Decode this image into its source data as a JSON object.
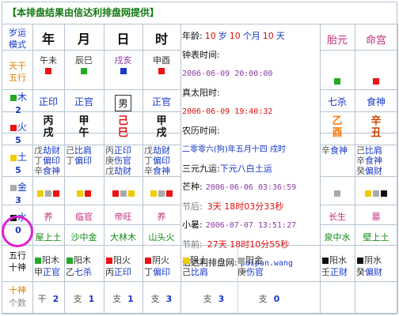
{
  "banner": "【本排盘结果由信达利排盘网提供】",
  "left": {
    "mode": [
      "岁运",
      "模式"
    ],
    "tiangan": [
      "天干",
      "五行"
    ],
    "elements": [
      {
        "name": "木",
        "count": "2",
        "color": "#22aa22"
      },
      {
        "name": "火",
        "count": "5",
        "color": "#ee1111"
      },
      {
        "name": "土",
        "count": "5",
        "color": "#eecc00"
      },
      {
        "name": "金",
        "count": "3",
        "color": "#aaaaaa"
      },
      {
        "name": "水",
        "count": "0",
        "color": "#111111"
      }
    ],
    "bottom1": [
      "五行",
      "十神"
    ],
    "bottom2": [
      "十神",
      "个数"
    ]
  },
  "pillars": {
    "headers": [
      "年",
      "月",
      "日",
      "时"
    ],
    "branches_sub": [
      "午未",
      "辰巳",
      "戌亥",
      "申酉"
    ],
    "branch_colors": [
      "#ee1111",
      "#22aa22",
      "#1838c8",
      "#ee1111"
    ],
    "shishen": [
      "正印",
      "正官",
      "男",
      "正官"
    ],
    "ganzhi": [
      {
        "gan": "丙",
        "zhi": "戌",
        "color": "#111"
      },
      {
        "gan": "甲",
        "zhi": "午",
        "color": "#111"
      },
      {
        "gan": "己",
        "zhi": "巳",
        "color": "#e01010"
      },
      {
        "gan": "甲",
        "zhi": "戌",
        "color": "#111"
      }
    ],
    "canggan": [
      [
        "戊劫财",
        "丁偏印",
        "辛食神"
      ],
      [
        "己比肩",
        "丁偏印",
        ""
      ],
      [
        "丙正印",
        "庚伤官",
        "戊劫财"
      ],
      [
        "戊劫财",
        "丁偏印",
        "辛食神"
      ]
    ],
    "dizhi_sq": [
      [
        "#eecc00",
        "#aaaaaa",
        "#ee1111"
      ],
      [
        "#eecc00",
        "#ee1111",
        ""
      ],
      [
        "#ee1111",
        "#aaaaaa",
        "#eecc00"
      ],
      [
        "#eecc00",
        "#aaaaaa",
        "#ee1111"
      ]
    ],
    "changsheng": [
      "养",
      "临官",
      "帝旺",
      "养"
    ],
    "nayin": [
      "屋上土",
      "沙中金",
      "大林木",
      "山头火"
    ],
    "bottom_wx": [
      [
        "阳木",
        "甲",
        "正官",
        "#22aa22"
      ],
      [
        "阳木",
        "乙",
        "七杀",
        "#22aa22"
      ],
      [
        "阳火",
        "丙",
        "正印",
        "#ee1111"
      ],
      [
        "阴火",
        "丁",
        "偏印",
        "#ee1111"
      ]
    ],
    "counts": [
      [
        "干",
        "2"
      ],
      [
        "支",
        "1"
      ],
      [
        "支",
        "1"
      ],
      [
        "支",
        "3"
      ]
    ]
  },
  "info": {
    "age_label": "年龄:",
    "age_num1": "10",
    "age_u1": "岁",
    "age_num2": "10",
    "age_u2": "个月",
    "age_num3": "10",
    "age_u3": "天",
    "clock_label": "钟表时间:",
    "clock_value": "2006-06-09 20:00:00",
    "solar_label": "真太阳时:",
    "solar_value": "2006-06-09 19:40:32",
    "lunar_label": "农历时间:",
    "lunar_value": "二零零六(狗)年五月十四 戌时",
    "yuan_label": "三元九运:",
    "yuan_value": "下元八白土运",
    "mangzhong_label": "芒种:",
    "mangzhong_value": "2006-06-06 03:36:59",
    "jieqian_label": "节后:",
    "jieqian_value": "3天 18时03分33秒",
    "xiaoshu_label": "小暑:",
    "xiaoshu_value": "2006-07-07 13:51:27",
    "jiehou_label": "节前:",
    "jiehou_value": "27天 18时10分55秒",
    "site_label": "信达利排盘网:",
    "site_value": "paipan.wang",
    "row_a": [
      "阴土",
      "己",
      "比肩",
      "#eecc00"
    ],
    "row_b": [
      "阳金",
      "庚",
      "伤官",
      "#aaaaaa"
    ],
    "count_a": [
      "支",
      "3"
    ],
    "count_b": [
      "支",
      "0"
    ]
  },
  "right": {
    "headers": [
      "胎元",
      "命宫"
    ],
    "sq_colors": [
      "#22aa22",
      "#ee1111"
    ],
    "shishen": [
      "七杀",
      "食神"
    ],
    "ganzhi": [
      {
        "gan": "乙",
        "zhi": "酉",
        "color": "#ff7700"
      },
      {
        "gan": "辛",
        "zhi": "丑",
        "color": "#cc4400"
      }
    ],
    "canggan": [
      [
        "辛食神",
        "",
        ""
      ],
      [
        "己比肩",
        "辛食神",
        "癸偏财"
      ]
    ],
    "dizhi_sq": [
      [
        "#aaaaaa"
      ],
      [
        "#eecc00",
        "#aaaaaa",
        "#111111"
      ]
    ],
    "changsheng": [
      "长生",
      "墓"
    ],
    "nayin": [
      "泉中水",
      "壁上土"
    ],
    "bottom_wx": [
      [
        "阳水",
        "壬",
        "正财",
        "#111111"
      ],
      [
        "阴水",
        "癸",
        "偏财",
        "#111111"
      ]
    ]
  }
}
